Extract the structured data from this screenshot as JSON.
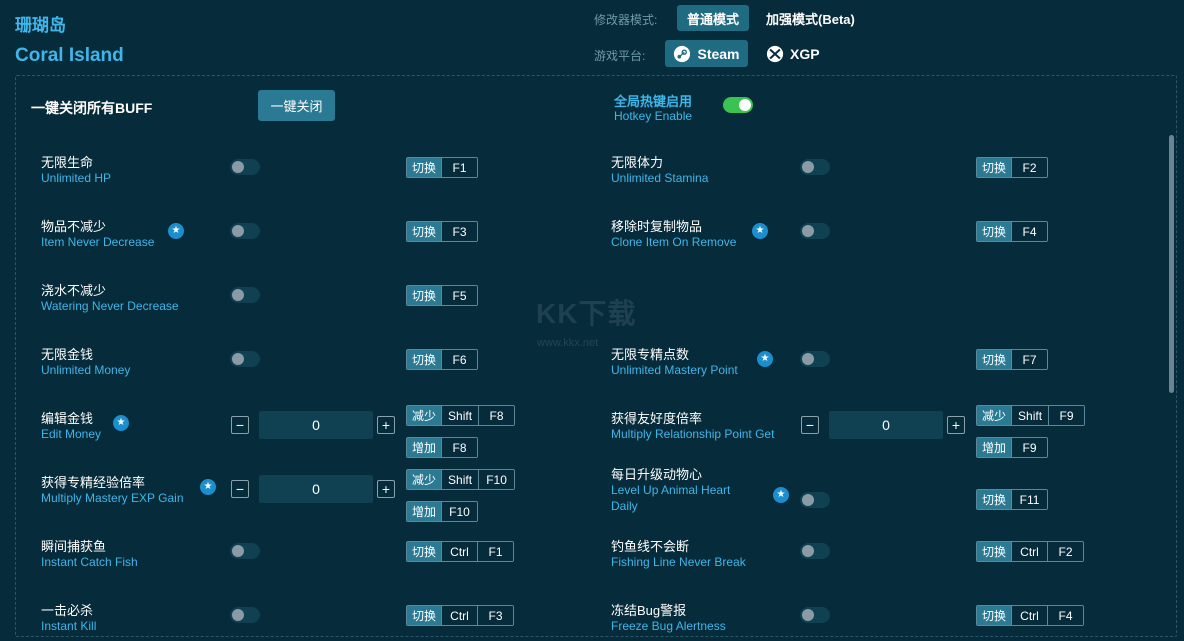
{
  "header": {
    "title_cn": "珊瑚岛",
    "title_en": "Coral Island",
    "mode_label": "修改器模式:",
    "mode_normal": "普通模式",
    "mode_beta": "加强模式(Beta)",
    "platform_label": "游戏平台:",
    "platform_steam": "Steam",
    "platform_xgp": "XGP"
  },
  "controls": {
    "close_all_label": "一键关闭所有BUFF",
    "close_all_button": "一键关闭",
    "hotkey_cn": "全局热键启用",
    "hotkey_en": "Hotkey Enable",
    "hotkey_enabled": true
  },
  "cheats": [
    {
      "cn": "无限生命",
      "en": "Unlimited HP",
      "keys": [
        {
          "action": "切换",
          "keys": [
            "F1"
          ]
        }
      ]
    },
    {
      "cn": "无限体力",
      "en": "Unlimited Stamina",
      "keys": [
        {
          "action": "切换",
          "keys": [
            "F2"
          ]
        }
      ]
    },
    {
      "cn": "物品不减少",
      "en": "Item Never Decrease",
      "star": true,
      "keys": [
        {
          "action": "切换",
          "keys": [
            "F3"
          ]
        }
      ]
    },
    {
      "cn": "移除时复制物品",
      "en": "Clone Item On Remove",
      "star": true,
      "keys": [
        {
          "action": "切换",
          "keys": [
            "F4"
          ]
        }
      ]
    },
    {
      "cn": "浇水不减少",
      "en": "Watering Never Decrease",
      "keys": [
        {
          "action": "切换",
          "keys": [
            "F5"
          ]
        }
      ]
    },
    {
      "cn": "无限金钱",
      "en": "Unlimited Money",
      "keys": [
        {
          "action": "切换",
          "keys": [
            "F6"
          ]
        }
      ]
    },
    {
      "cn": "无限专精点数",
      "en": "Unlimited Mastery Point",
      "star": true,
      "keys": [
        {
          "action": "切换",
          "keys": [
            "F7"
          ]
        }
      ]
    },
    {
      "cn": "编辑金钱",
      "en": "Edit Money",
      "star": true,
      "value": "0",
      "keys": [
        {
          "action": "减少",
          "keys": [
            "Shift",
            "F8"
          ]
        },
        {
          "action": "增加",
          "keys": [
            "F8"
          ]
        }
      ]
    },
    {
      "cn": "获得友好度倍率",
      "en": "Multiply Relationship Point Get",
      "value": "0",
      "keys": [
        {
          "action": "减少",
          "keys": [
            "Shift",
            "F9"
          ]
        },
        {
          "action": "增加",
          "keys": [
            "F9"
          ]
        }
      ]
    },
    {
      "cn": "获得专精经验倍率",
      "en": "Multiply Mastery EXP Gain",
      "star": true,
      "value": "0",
      "keys": [
        {
          "action": "减少",
          "keys": [
            "Shift",
            "F10"
          ]
        },
        {
          "action": "增加",
          "keys": [
            "F10"
          ]
        }
      ]
    },
    {
      "cn": "每日升级动物心",
      "en": "Level Up Animal Heart",
      "en2": "Daily",
      "star": true,
      "keys": [
        {
          "action": "切换",
          "keys": [
            "F11"
          ]
        }
      ]
    },
    {
      "cn": "瞬间捕获鱼",
      "en": "Instant Catch Fish",
      "keys": [
        {
          "action": "切换",
          "keys": [
            "Ctrl",
            "F1"
          ]
        }
      ]
    },
    {
      "cn": "钓鱼线不会断",
      "en": "Fishing Line Never Break",
      "keys": [
        {
          "action": "切换",
          "keys": [
            "Ctrl",
            "F2"
          ]
        }
      ]
    },
    {
      "cn": "一击必杀",
      "en": "Instant Kill",
      "keys": [
        {
          "action": "切换",
          "keys": [
            "Ctrl",
            "F3"
          ]
        }
      ]
    },
    {
      "cn": "冻结Bug警报",
      "en": "Freeze Bug Alertness",
      "keys": [
        {
          "action": "切换",
          "keys": [
            "Ctrl",
            "F4"
          ]
        }
      ]
    }
  ],
  "icons": {
    "steam": "steam-icon",
    "xgp": "xbox-icon",
    "star": "star-icon"
  },
  "watermark": {
    "text": "KK下载",
    "url": "www.kkx.net"
  }
}
